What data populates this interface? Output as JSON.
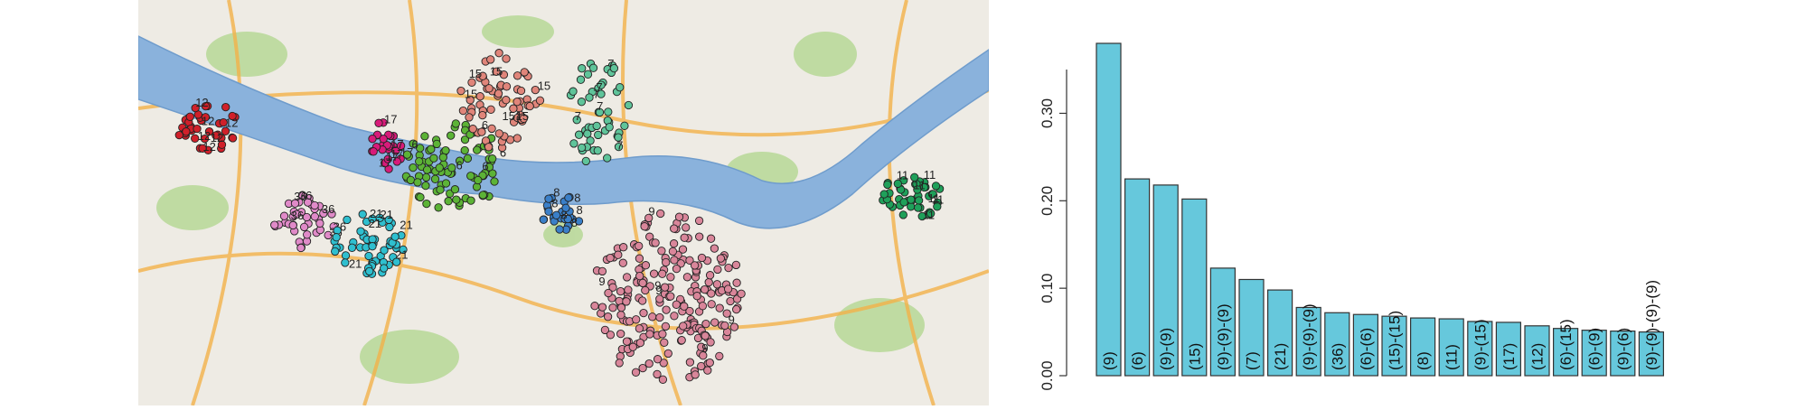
{
  "map": {
    "clusters": [
      {
        "label": "12",
        "color": "#d0202a"
      },
      {
        "label": "17",
        "color": "#d81b7a"
      },
      {
        "label": "6",
        "color": "#5cb336"
      },
      {
        "label": "15",
        "color": "#e0857a"
      },
      {
        "label": "7",
        "color": "#5fc49a"
      },
      {
        "label": "8",
        "color": "#3a7fc8"
      },
      {
        "label": "36",
        "color": "#e08ac8"
      },
      {
        "label": "21",
        "color": "#2fbfcf"
      },
      {
        "label": "9",
        "color": "#d9869a"
      },
      {
        "label": "11",
        "color": "#1fa05a"
      }
    ]
  },
  "chart_data": {
    "type": "bar",
    "categories": [
      "(9)",
      "(6)",
      "(9)-(9)",
      "(15)",
      "(9)-(9)-(9)",
      "(7)",
      "(21)",
      "(9)-(9)-(9)",
      "(36)",
      "(6)-(6)",
      "(15)-(15)",
      "(8)",
      "(11)",
      "(9)-(15)",
      "(17)",
      "(12)",
      "(6)-(15)",
      "(6)-(9)",
      "(9)-(6)",
      "(9)-(9)-(9)-(9)"
    ],
    "values": [
      0.38,
      0.225,
      0.218,
      0.202,
      0.123,
      0.11,
      0.098,
      0.078,
      0.072,
      0.07,
      0.068,
      0.066,
      0.065,
      0.062,
      0.061,
      0.057,
      0.054,
      0.052,
      0.051,
      0.05
    ],
    "yticks": [
      "0.00",
      "0.10",
      "0.20",
      "0.30"
    ],
    "ylim": [
      0,
      0.38
    ],
    "bar_color": "#66c8dc",
    "title": "",
    "xlabel": "",
    "ylabel": ""
  }
}
